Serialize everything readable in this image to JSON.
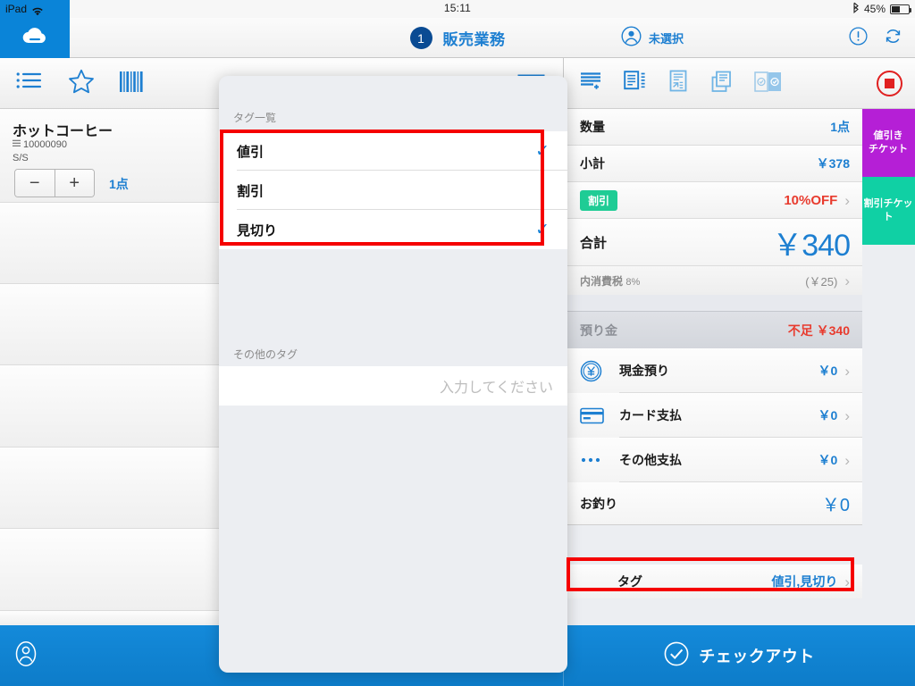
{
  "status_bar": {
    "device": "iPad",
    "wifi_icon": "wifi-icon",
    "time": "15:11",
    "bluetooth_icon": "bluetooth-icon",
    "battery_percent": "45%"
  },
  "header": {
    "cloud_icon": "cloud-icon",
    "badge_count": "1",
    "title": "販売業務",
    "user_icon": "person-circle-icon",
    "user_label": "未選択",
    "alert_icon": "exclamation-circle-icon",
    "sync_icon": "refresh-icon"
  },
  "left_panel": {
    "toolbar_left_icons": [
      "list-icon",
      "star-icon",
      "barcode-icon"
    ],
    "toolbar_right_icons": [
      "folder-icon",
      "drawer-icon"
    ],
    "cart_item": {
      "name": "ホットコーヒー",
      "code_icon": "menu-lines-icon",
      "code": "10000090",
      "variant": "S/S",
      "minus_label": "−",
      "plus_label": "+",
      "quantity": "1点"
    }
  },
  "right_panel": {
    "toolbar_icons": [
      "new-order-icon",
      "orders-list-icon",
      "receipt-icon",
      "copy-icon",
      "select-toggle-icon"
    ],
    "record_button": "stop-record-button",
    "summary_rows": [
      {
        "label": "数量",
        "value": "1点",
        "chevron": false
      },
      {
        "label": "小計",
        "value": "￥378",
        "chevron": false
      }
    ],
    "discount_row": {
      "chip_label": "割引",
      "value": "10%OFF",
      "chevron": true
    },
    "total_row": {
      "label": "合計",
      "value": "￥340"
    },
    "tax_row": {
      "label": "内消費税",
      "rate": "8%",
      "value": "(￥25)",
      "chevron": true
    },
    "deposit_head": {
      "label": "預り金",
      "value": "不足 ￥340"
    },
    "payment_rows": [
      {
        "icon": "yen-coin-icon",
        "label": "現金預り",
        "value": "￥0",
        "chevron": true
      },
      {
        "icon": "credit-card-icon",
        "label": "カード支払",
        "value": "￥0",
        "chevron": true
      },
      {
        "icon": "ellipsis-icon",
        "label": "その他支払",
        "value": "￥0",
        "chevron": true
      }
    ],
    "change_row": {
      "label": "お釣り",
      "value": "￥0"
    },
    "tag_row": {
      "label": "タグ",
      "value": "値引,見切り",
      "chevron": true
    },
    "tickets": [
      {
        "name": "discount-ticket",
        "line1": "値引き",
        "line2": "チケット",
        "color": "#b51fd6"
      },
      {
        "name": "coupon-ticket",
        "line1": "割引チケット",
        "line2": "",
        "color": "#10d0a4"
      }
    ]
  },
  "bottom_bar": {
    "customer_icon": "person-outline-icon",
    "checkout_icon": "check-circle-icon",
    "checkout_label": "チェックアウト"
  },
  "modal": {
    "tag_list_label": "タグ一覧",
    "tag_items": [
      {
        "label": "値引",
        "checked": true
      },
      {
        "label": "割引",
        "checked": false
      },
      {
        "label": "見切り",
        "checked": true
      }
    ],
    "other_tag_label": "その他のタグ",
    "other_tag_value": "",
    "other_tag_placeholder": "入力してください",
    "check_glyph": "✓"
  },
  "colors": {
    "accent_blue": "#1d7fd1",
    "brand_blue": "#0a84d8",
    "alert_red": "#e83b2e",
    "highlight_red": "#f50000",
    "green_chip": "#1fcc95",
    "purple_ticket": "#b51fd6",
    "teal_ticket": "#10d0a4"
  }
}
